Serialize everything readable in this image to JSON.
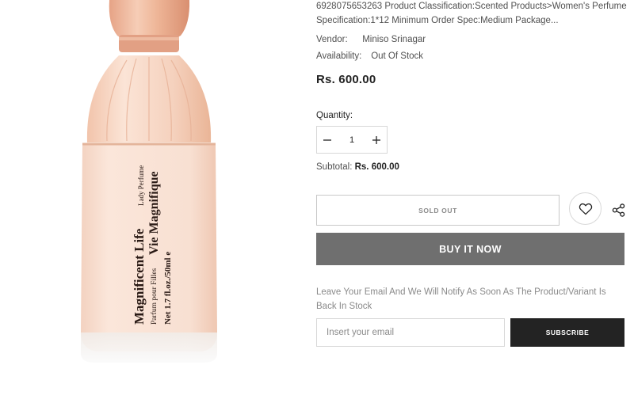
{
  "product": {
    "description_line1": "6928075653263 Product Classification:Scented Products>Women's Perfume",
    "description_line2": "Specification:1*12 Minimum Order Spec:Medium Package...",
    "vendor_label": "Vendor:",
    "vendor_value": "Miniso Srinagar",
    "availability_label": "Availability:",
    "availability_value": "Out Of Stock",
    "price": "Rs. 600.00",
    "bottle_text": {
      "line1_main": "Magnificent Life",
      "line1_small": "Lady Perfume",
      "line2_small": "Parfum pour Filles",
      "line2_main": "Vie Magnifique",
      "line3": "Net 1.7 fl.oz./50ml e"
    }
  },
  "quantity": {
    "label": "Quantity:",
    "value": "1",
    "minus_icon": "minus-icon",
    "plus_icon": "plus-icon"
  },
  "subtotal": {
    "label": "Subtotal:",
    "value": "Rs. 600.00"
  },
  "actions": {
    "sold_out_label": "SOLD OUT",
    "wishlist_icon": "heart-icon",
    "share_icon": "share-icon",
    "buy_now_label": "BUY IT NOW"
  },
  "notify": {
    "message": "Leave Your Email And We Will Notify As Soon As The Product/Variant Is Back In Stock",
    "email_placeholder": "Insert your email",
    "subscribe_label": "SUBSCRIBE"
  },
  "colors": {
    "buy_now_bg": "#6f6f6f",
    "subscribe_bg": "#232323",
    "bottle_cap": "#e9a98c",
    "bottle_body": "#f6dccd"
  }
}
